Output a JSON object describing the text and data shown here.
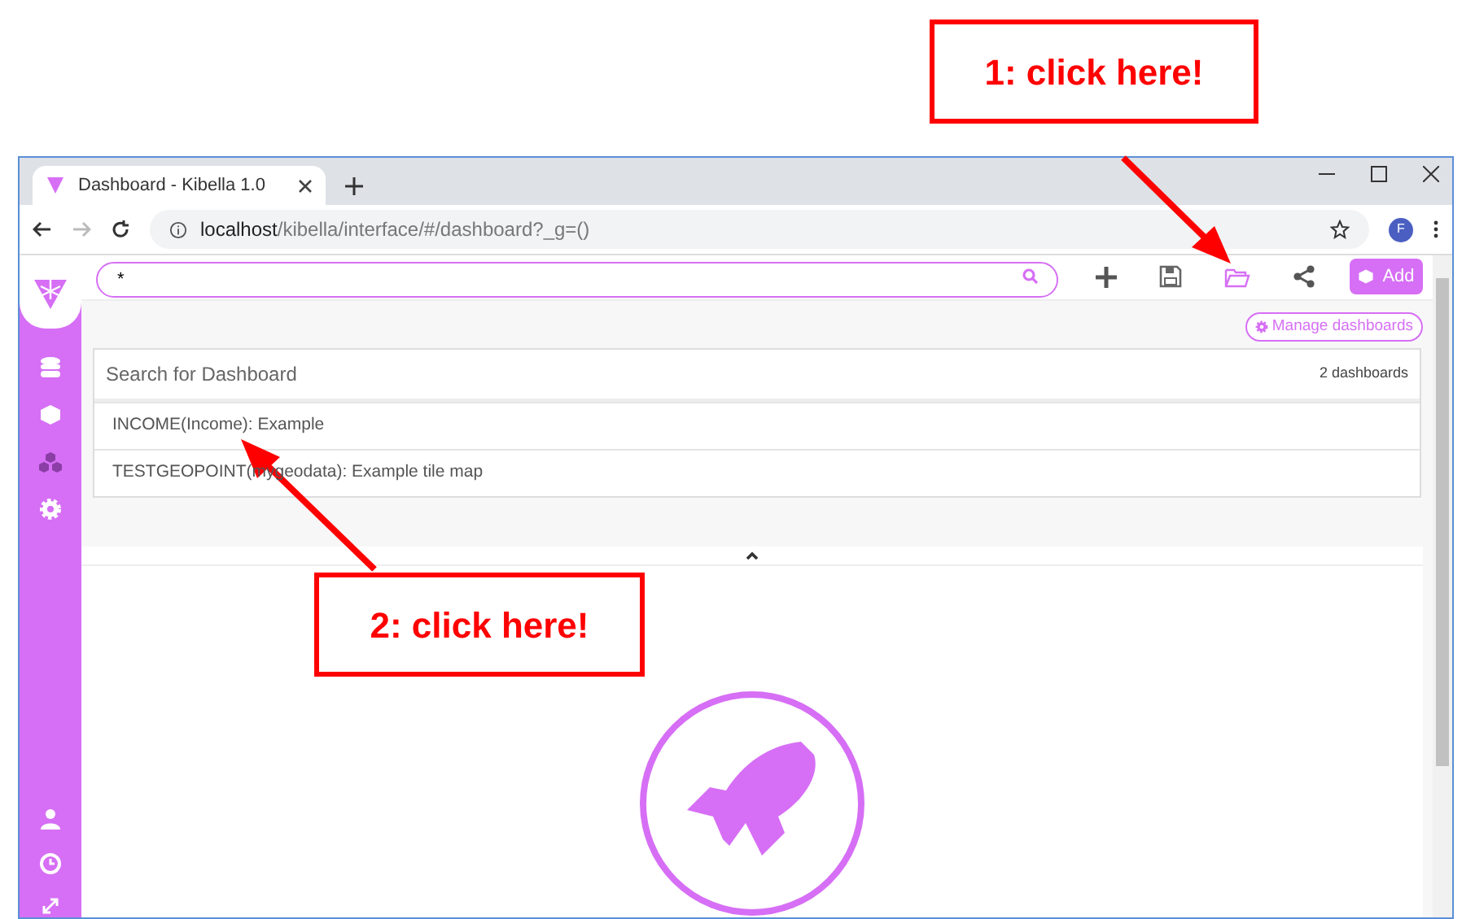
{
  "annotations": [
    {
      "text": "1: click here!"
    },
    {
      "text": "2: click here!"
    }
  ],
  "browser": {
    "tab_title": "Dashboard - Kibella 1.0",
    "url_host": "localhost",
    "url_path": "/kibella/interface/#/dashboard?_g=()",
    "profile_initial": "F"
  },
  "toolbar": {
    "search_value": "*",
    "add_button": "Add"
  },
  "manage_button": "Manage dashboards",
  "dashboard_list": {
    "search_placeholder": "Search for Dashboard",
    "count": "2 dashboards",
    "items": [
      "INCOME(Income): Example",
      "TESTGEOPOINT(mygeodata): Example tile map"
    ]
  }
}
